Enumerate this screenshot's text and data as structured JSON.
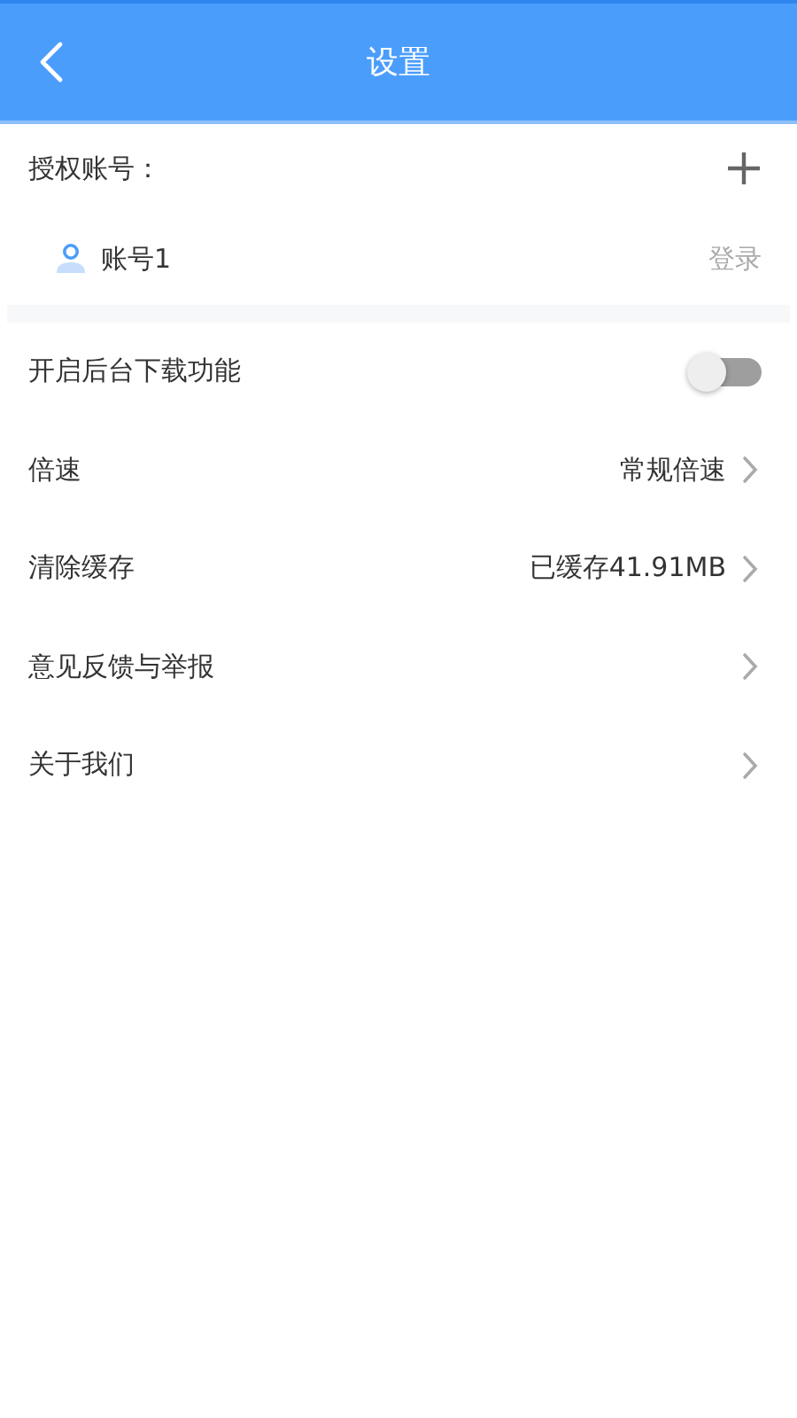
{
  "header": {
    "title": "设置"
  },
  "accounts": {
    "label": "授权账号：",
    "items": [
      {
        "name": "账号1",
        "action": "登录"
      }
    ]
  },
  "settings": [
    {
      "kind": "toggle",
      "label": "开启后台下载功能",
      "on": false
    },
    {
      "kind": "link",
      "label": "倍速",
      "value": "常规倍速"
    },
    {
      "kind": "link",
      "label": "清除缓存",
      "value": "已缓存41.91MB"
    },
    {
      "kind": "link",
      "label": "意见反馈与举报"
    },
    {
      "kind": "link",
      "label": "关于我们"
    }
  ]
}
